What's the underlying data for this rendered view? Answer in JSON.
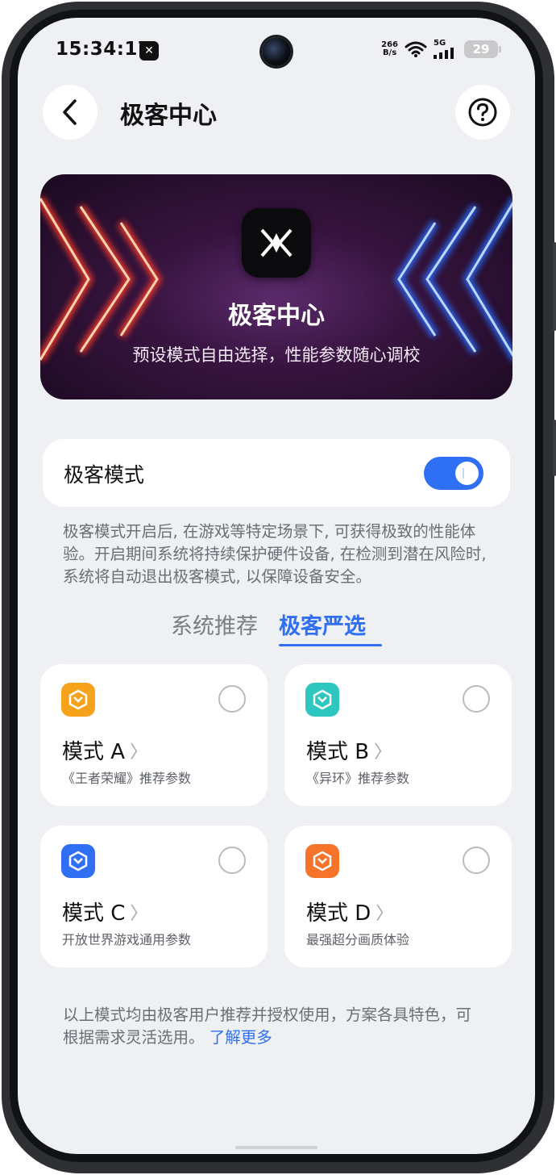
{
  "status": {
    "time": "15:34:17",
    "net_speed_top": "266",
    "net_speed_bottom": "B/s",
    "network": "5G",
    "battery": "29"
  },
  "header": {
    "title": "极客中心"
  },
  "banner": {
    "title": "极客中心",
    "subtitle": "预设模式自由选择，性能参数随心调校"
  },
  "geek_mode": {
    "label": "极客模式",
    "enabled": true,
    "description": "极客模式开启后, 在游戏等特定场景下, 可获得极致的性能体验。开启期间系统将持续保护硬件设备, 在检测到潜在风险时, 系统将自动退出极客模式, 以保障设备安全。"
  },
  "tabs": [
    {
      "label": "系统推荐",
      "selected": false
    },
    {
      "label": "极客严选",
      "selected": true
    }
  ],
  "modes": [
    {
      "name": "模式 A",
      "desc": "《王者荣耀》推荐参数",
      "icon_color": "#f7a21b"
    },
    {
      "name": "模式 B",
      "desc": "《异环》推荐参数",
      "icon_color": "#2ec7c0"
    },
    {
      "name": "模式 C",
      "desc": "开放世界游戏通用参数",
      "icon_color": "#2f6ff4"
    },
    {
      "name": "模式 D",
      "desc": "最强超分画质体验",
      "icon_color": "#f5742a"
    }
  ],
  "footer": {
    "note": "以上模式均由极客用户推荐并授权使用，方案各具特色，可根据需求灵活选用。",
    "link": "了解更多"
  },
  "colors": {
    "accent": "#2f6ff4",
    "background": "#eef0f4",
    "card": "#ffffff"
  }
}
